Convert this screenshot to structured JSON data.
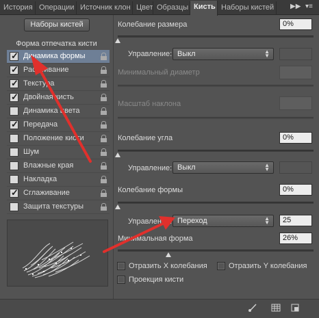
{
  "tabs": [
    "История",
    "Операции",
    "Источник клон",
    "Цвет",
    "Образцы",
    "Кисть",
    "Наборы кистей"
  ],
  "active_tab": "Кисть",
  "tab_more_icon": "double-chevron-right-icon",
  "panel_menu_icon": "panel-menu-icon",
  "left": {
    "presets_button": "Наборы кистей",
    "section_title": "Форма отпечатка кисти",
    "options": [
      {
        "label": "Динамика формы",
        "checked": true,
        "selected": true
      },
      {
        "label": "Рассеивание",
        "checked": true,
        "selected": false
      },
      {
        "label": "Текстура",
        "checked": true,
        "selected": false
      },
      {
        "label": "Двойная кисть",
        "checked": true,
        "selected": false
      },
      {
        "label": "Динамика цвета",
        "checked": false,
        "selected": false
      },
      {
        "label": "Передача",
        "checked": true,
        "selected": false
      },
      {
        "label": "Положение кисти",
        "checked": false,
        "selected": false
      },
      {
        "label": "Шум",
        "checked": false,
        "selected": false
      },
      {
        "label": "Влажные края",
        "checked": false,
        "selected": false
      },
      {
        "label": "Накладка",
        "checked": false,
        "selected": false
      },
      {
        "label": "Сглаживание",
        "checked": true,
        "selected": false
      },
      {
        "label": "Защита текстуры",
        "checked": false,
        "selected": false
      }
    ]
  },
  "right": {
    "size_jitter_label": "Колебание размера",
    "size_jitter_value": "0%",
    "size_control_label": "Управление:",
    "size_control_value": "Выкл",
    "min_diameter_label": "Минимальный диаметр",
    "tilt_scale_label": "Масштаб наклона",
    "angle_jitter_label": "Колебание угла",
    "angle_jitter_value": "0%",
    "angle_control_label": "Управление:",
    "angle_control_value": "Выкл",
    "roundness_jitter_label": "Колебание формы",
    "roundness_jitter_value": "0%",
    "roundness_control_label": "Управление:",
    "roundness_control_value": "Переход",
    "roundness_control_steps": "25",
    "min_roundness_label": "Минимальная форма",
    "min_roundness_value": "26%",
    "flip_x_label": "Отразить X колебания",
    "flip_y_label": "Отразить Y колебания",
    "brush_projection_label": "Проекция кисти"
  },
  "bottom": {
    "icons": [
      "brush-toggle-icon",
      "grid-icon",
      "new-preset-icon"
    ]
  },
  "colors": {
    "panel_bg": "#535353",
    "tab_bar_bg": "#3a3a3a",
    "selected_row": "#6e7f96",
    "annotation_red": "#e0302c"
  }
}
